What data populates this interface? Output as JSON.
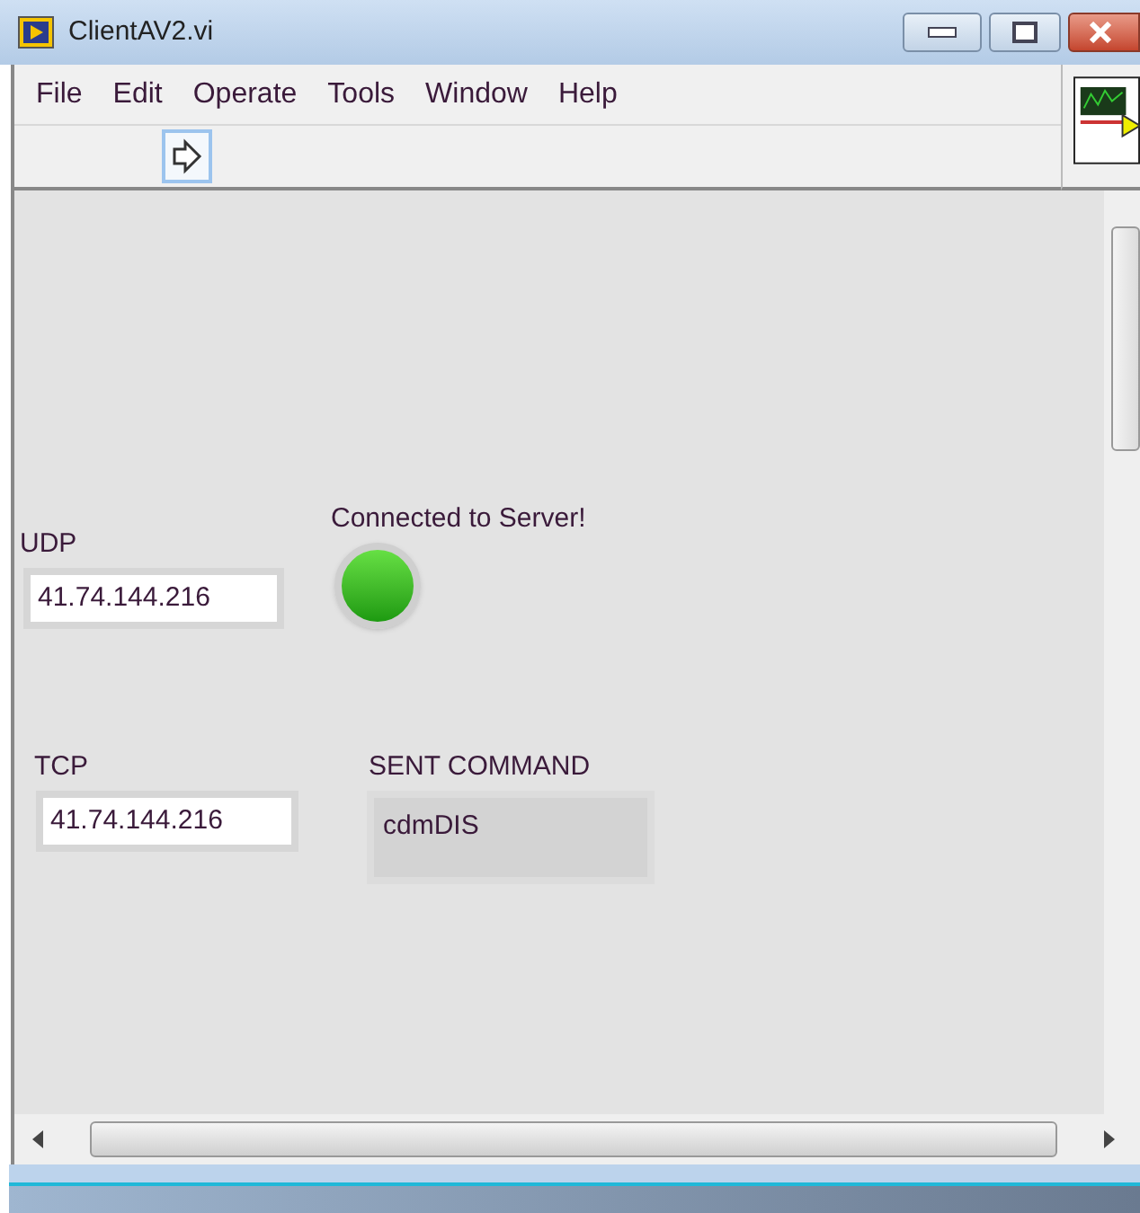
{
  "window": {
    "title": "ClientAV2.vi"
  },
  "menu": [
    "File",
    "Edit",
    "Operate",
    "Tools",
    "Window",
    "Help"
  ],
  "panel": {
    "udp": {
      "label": "UDP",
      "value": "41.74.144.216"
    },
    "led": {
      "label": "Connected to Server!",
      "on": true
    },
    "tcp": {
      "label": "TCP",
      "value": "41.74.144.216"
    },
    "sent_command": {
      "label": "SENT COMMAND",
      "value": "cdmDIS"
    }
  }
}
